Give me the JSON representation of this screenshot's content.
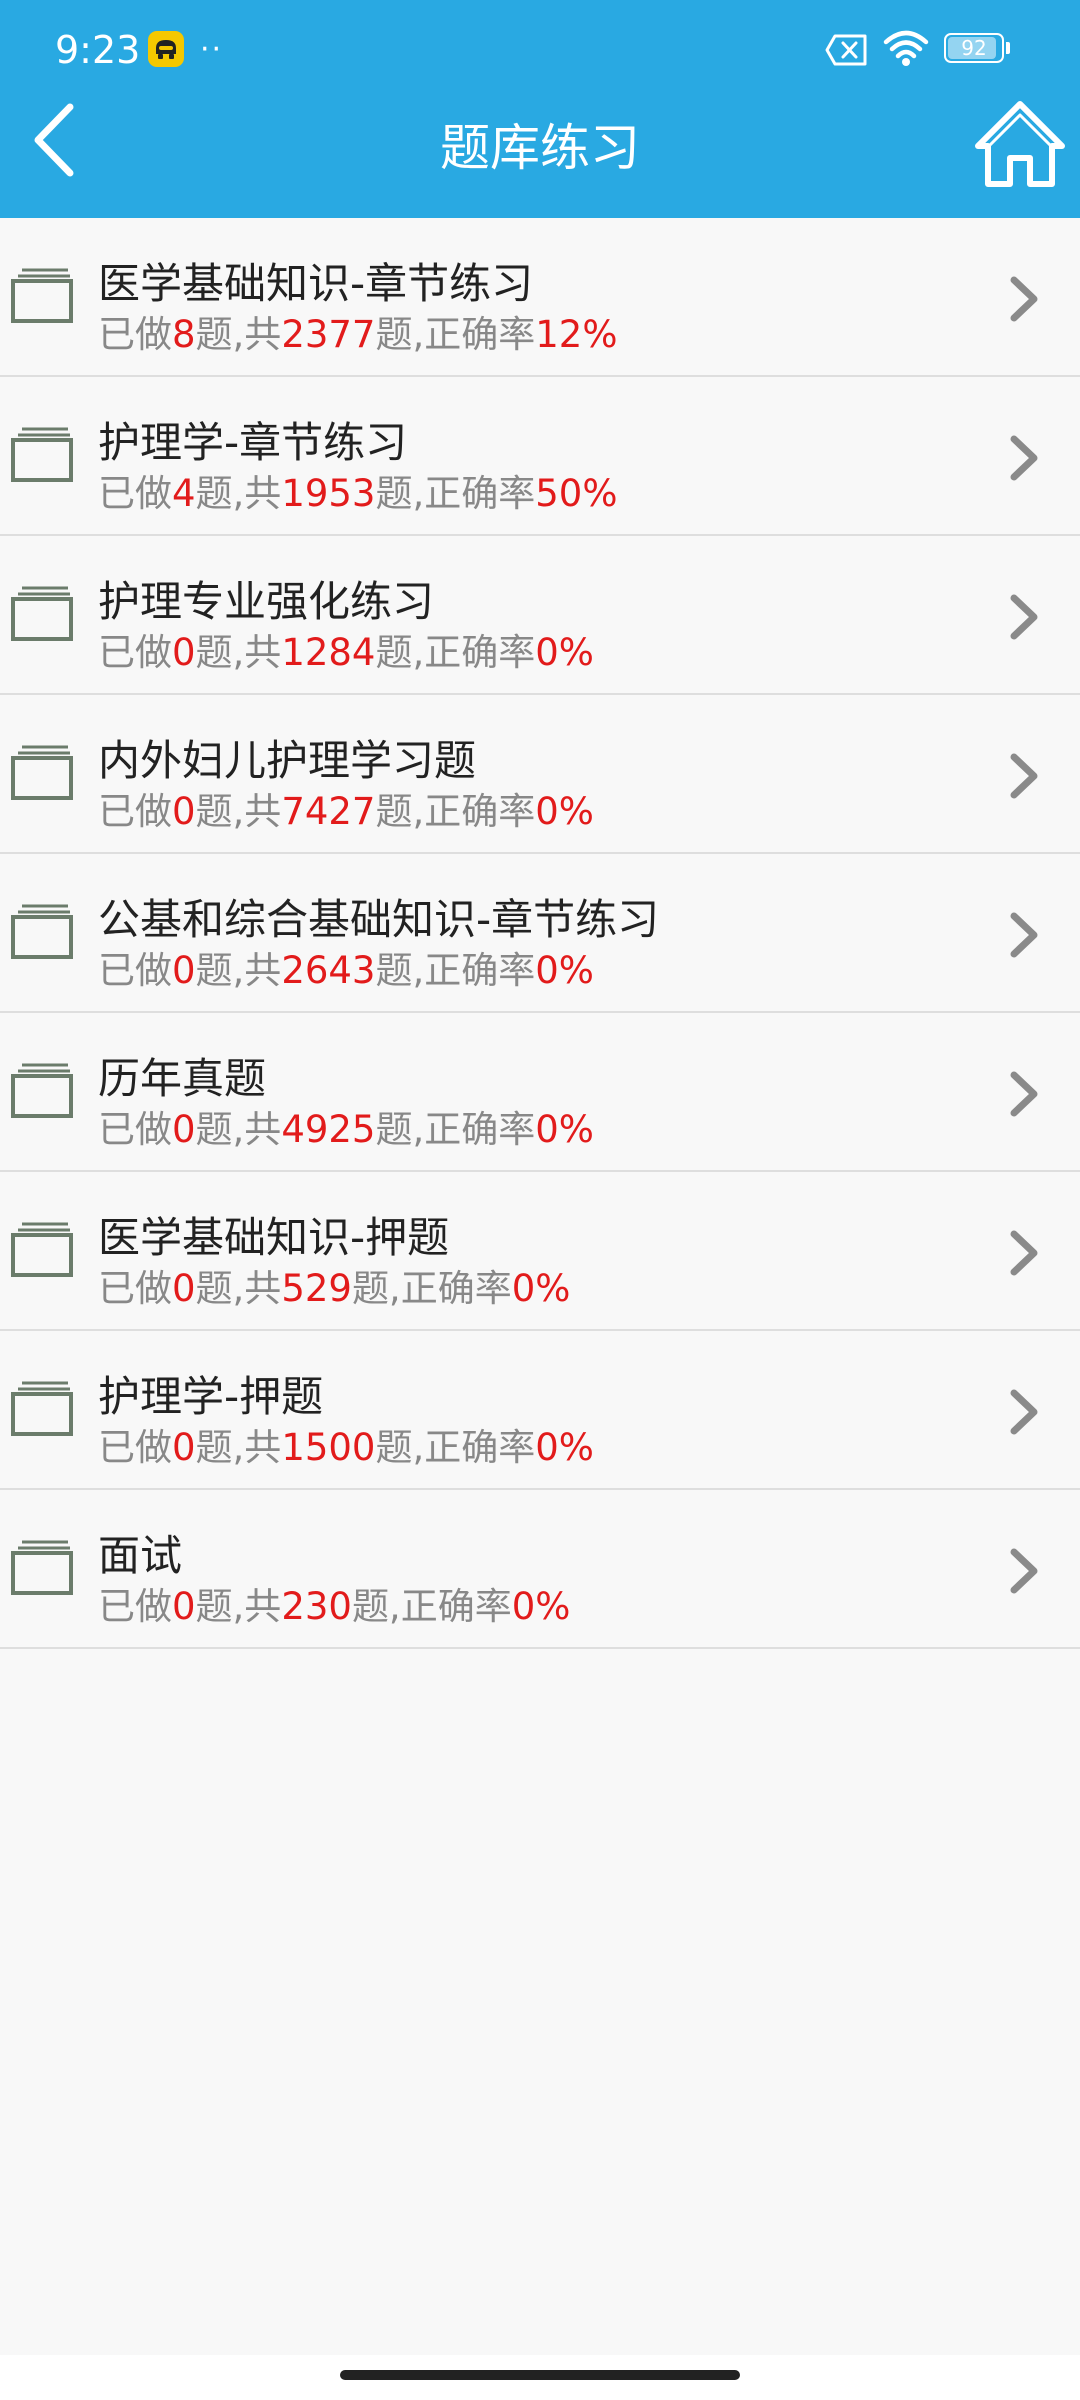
{
  "status_bar": {
    "time": "9:23",
    "dots": "··",
    "battery": "92",
    "battery_level": 0.92,
    "icons": [
      "app-notification-icon",
      "sim-x-icon",
      "wifi-icon",
      "battery-icon"
    ]
  },
  "header": {
    "title": "题库练习",
    "back_icon": "chevron-left-icon",
    "home_icon": "home-icon",
    "color": "#29a9e2"
  },
  "colors": {
    "accent_red": "#e21b1b",
    "subtext": "#888888",
    "title_text": "#222222"
  },
  "sub_text": {
    "done_prefix": "已做",
    "done_suffix": "题,共",
    "total_suffix": "题,正确率"
  },
  "items": [
    {
      "title": "医学基础知识-章节练习",
      "done": "8",
      "total": "2377",
      "accuracy": "12%"
    },
    {
      "title": "护理学-章节练习",
      "done": "4",
      "total": "1953",
      "accuracy": "50%"
    },
    {
      "title": "护理专业强化练习",
      "done": "0",
      "total": "1284",
      "accuracy": "0%"
    },
    {
      "title": "内外妇儿护理学习题",
      "done": "0",
      "total": "7427",
      "accuracy": "0%"
    },
    {
      "title": "公基和综合基础知识-章节练习",
      "done": "0",
      "total": "2643",
      "accuracy": "0%"
    },
    {
      "title": "历年真题",
      "done": "0",
      "total": "4925",
      "accuracy": "0%"
    },
    {
      "title": "医学基础知识-押题",
      "done": "0",
      "total": "529",
      "accuracy": "0%"
    },
    {
      "title": "护理学-押题",
      "done": "0",
      "total": "1500",
      "accuracy": "0%"
    },
    {
      "title": "面试",
      "done": "0",
      "total": "230",
      "accuracy": "0%"
    }
  ]
}
